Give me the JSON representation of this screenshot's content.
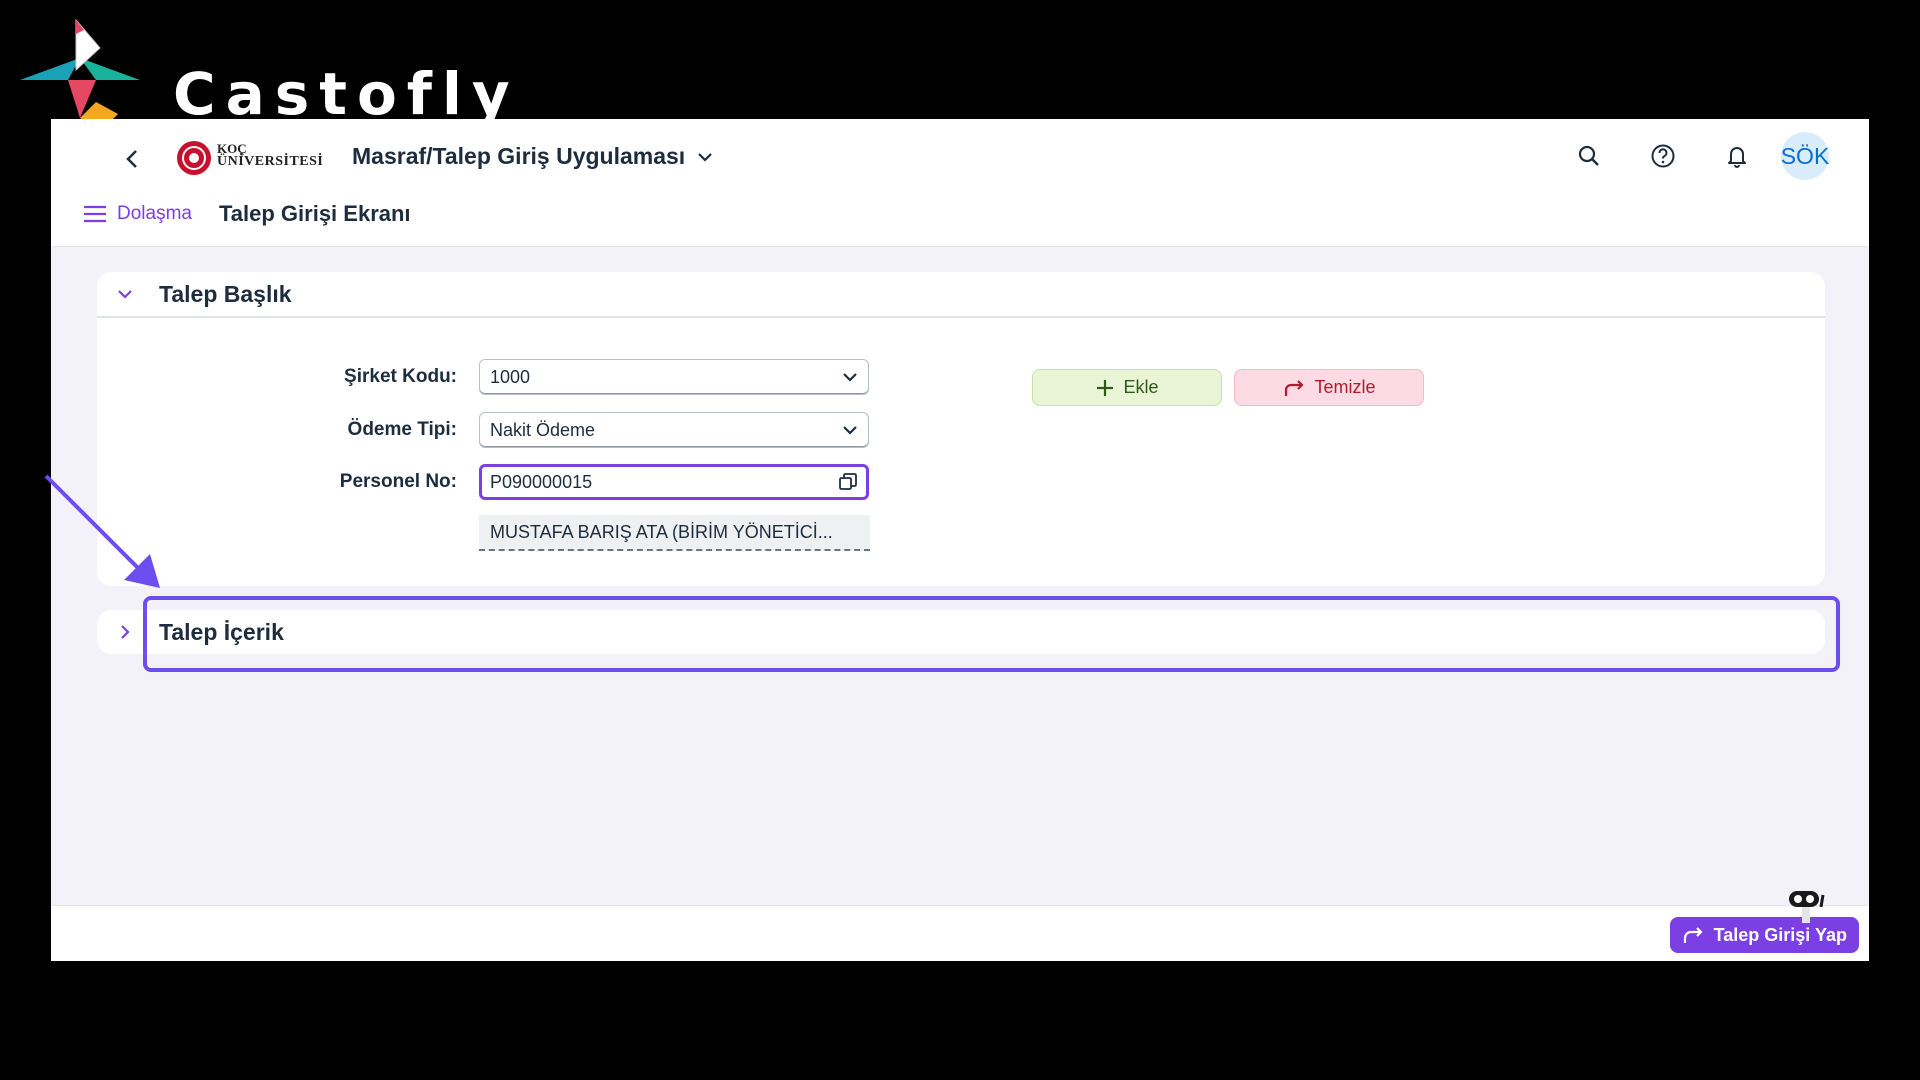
{
  "brand": {
    "name": "Castofly",
    "logo_icon": "castofly-logo-icon"
  },
  "shellbar": {
    "back_icon": "chevron-left-icon",
    "org_logo_line1": "KOÇ",
    "org_logo_line2": "ÜNİVERSİTESİ",
    "app_title": "Masraf/Talep Giriş Uygulaması",
    "icons": [
      "search-icon",
      "help-icon",
      "bell-icon"
    ],
    "avatar_initials": "SÖK"
  },
  "subbar": {
    "nav_label": "Dolaşma",
    "page_title": "Talep Girişi Ekranı"
  },
  "header_panel": {
    "title": "Talep Başlık",
    "fields": {
      "company_label": "Şirket Kodu:",
      "company_value": "1000",
      "payment_label": "Ödeme Tipi:",
      "payment_value": "Nakit Ödeme",
      "personnel_label": "Personel No:",
      "personnel_value": "P090000015",
      "personnel_desc": "MUSTAFA BARIŞ  ATA (BİRİM YÖNETİCİ..."
    },
    "add_button": "Ekle",
    "clear_button": "Temizle"
  },
  "content_panel": {
    "title": "Talep İçerik"
  },
  "footer": {
    "submit_button": "Talep Girişi Yap"
  },
  "colors": {
    "accent": "#7b3fe4",
    "highlight": "#6c4df0",
    "add_bg": "#eaf5d8",
    "clear_bg": "#fcdbe4"
  }
}
